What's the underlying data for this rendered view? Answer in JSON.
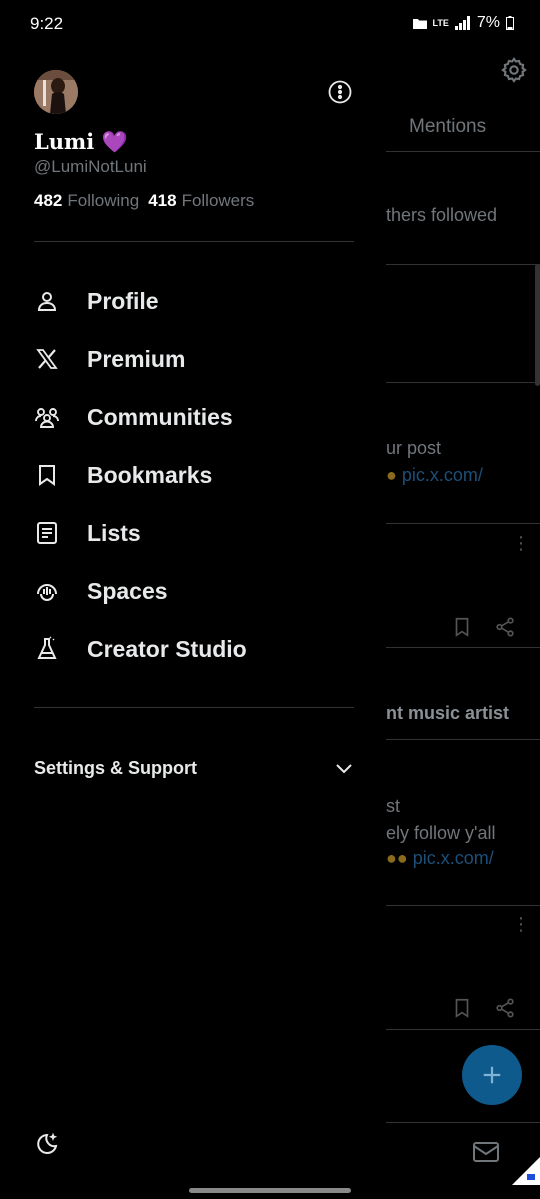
{
  "status_bar": {
    "time": "9:22",
    "battery": "7%",
    "network": "LTE"
  },
  "feed": {
    "tab_mentions": "Mentions",
    "snippets": {
      "others_followed": "thers followed",
      "your_post": "ur post",
      "pic_link_1": "pic.x.com/",
      "music_artist": "nt music artist",
      "st": "st",
      "follow_yall": "ely follow y'all",
      "pic_link_2": "pic.x.com/"
    },
    "fab_symbol": "+"
  },
  "drawer": {
    "profile": {
      "display_name": "Lumi",
      "name_emoji": "💜",
      "handle": "@LumiNotLuni",
      "following_count": "482",
      "following_label": "Following",
      "followers_count": "418",
      "followers_label": "Followers"
    },
    "menu": [
      {
        "label": "Profile",
        "icon": "person-icon"
      },
      {
        "label": "Premium",
        "icon": "x-logo-icon"
      },
      {
        "label": "Communities",
        "icon": "communities-icon"
      },
      {
        "label": "Bookmarks",
        "icon": "bookmark-icon"
      },
      {
        "label": "Lists",
        "icon": "list-icon"
      },
      {
        "label": "Spaces",
        "icon": "spaces-icon"
      },
      {
        "label": "Creator Studio",
        "icon": "flask-icon"
      }
    ],
    "settings_support_label": "Settings & Support"
  },
  "colors": {
    "accent": "#1d9bf0",
    "muted_text": "#71767b",
    "divider": "#2f3336"
  }
}
